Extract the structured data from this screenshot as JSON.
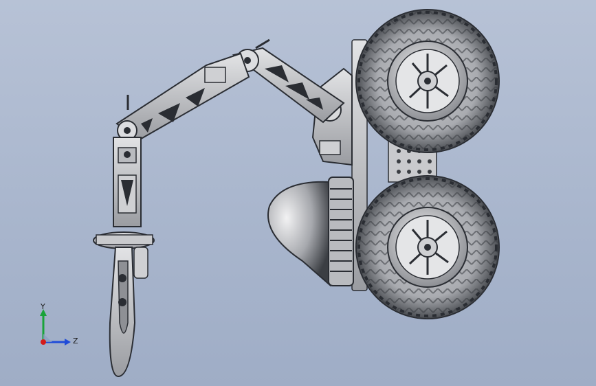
{
  "viewport": {
    "background_top": "#b7c2d6",
    "background_bottom": "#9fadc6"
  },
  "model": {
    "shade_dark": "#2a2d33",
    "shade_mid": "#8c8f95",
    "shade_light": "#dcdde0"
  },
  "triad": {
    "y_label": "Y",
    "z_label": "Z",
    "y_color": "#19a33a",
    "z_color": "#1f4bd8",
    "x_color": "#d41b1b"
  }
}
